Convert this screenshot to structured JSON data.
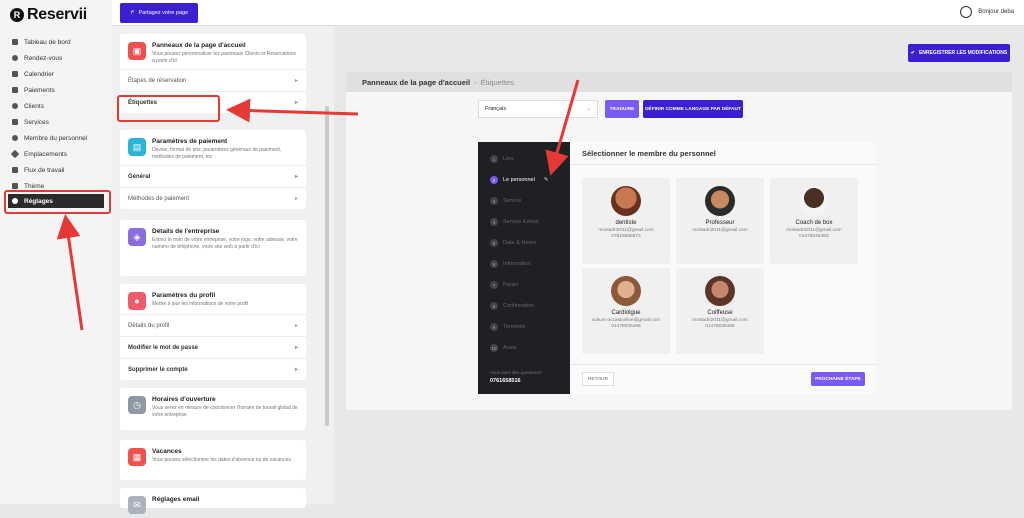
{
  "brand": {
    "logo_letter": "R",
    "name": "Reservii"
  },
  "sidebar": {
    "items": [
      {
        "label": "Tableau de bord",
        "icon": "dashboard-icon"
      },
      {
        "label": "Rendez-vous",
        "icon": "clock-icon"
      },
      {
        "label": "Calendrier",
        "icon": "calendar-icon"
      },
      {
        "label": "Paiements",
        "icon": "payment-icon"
      },
      {
        "label": "Clients",
        "icon": "users-icon"
      },
      {
        "label": "Services",
        "icon": "services-icon"
      },
      {
        "label": "Membre du personnel",
        "icon": "user-icon"
      },
      {
        "label": "Emplacements",
        "icon": "location-icon"
      },
      {
        "label": "Flux de travail",
        "icon": "workflow-icon"
      },
      {
        "label": "Thème",
        "icon": "theme-icon"
      },
      {
        "label": "Réglages",
        "icon": "gear-icon"
      }
    ]
  },
  "topbar": {
    "share_label": "Partagez votre page",
    "user_label": "Bonjour deba"
  },
  "settings": {
    "cards": [
      {
        "title": "Panneaux de la page d'accueil",
        "desc": "Vous pouvez personnaliser les panneaux Clients et Réservations à partir d'ici",
        "rows": [
          "Étapes de réservation",
          "Étiquettes"
        ]
      },
      {
        "title": "Paramètres de paiement",
        "desc": "Devise, format de prix, paramètres généraux de paiement, méthodes de paiement, etc",
        "rows": [
          "Général",
          "Méthodes de paiement"
        ]
      },
      {
        "title": "Détails de l'entreprise",
        "desc": "Entrez le nom de votre entreprise, votre logo, votre adresse, votre numéro de téléphone, votre site web à partir d'ici",
        "rows": []
      },
      {
        "title": "Paramètres du profil",
        "desc": "Mettre à jour les informations de votre profil",
        "rows": [
          "Détails du profil",
          "Modifier le mot de passe",
          "Supprimer le compte"
        ]
      },
      {
        "title": "Horaires d'ouverture",
        "desc": "Vous serez en mesure de coordonner l'horaire de travail global de votre entreprise",
        "rows": []
      },
      {
        "title": "Vacances",
        "desc": "Vous pouvez sélectionner les dates d'absence ou de vacances",
        "rows": []
      },
      {
        "title": "Réglages email",
        "desc": "",
        "rows": []
      }
    ]
  },
  "main": {
    "save_label": "ENREGISTRER LES MODIFICATIONS",
    "breadcrumb_title": "Panneaux de la page d'accueil",
    "breadcrumb_sep": "-",
    "breadcrumb_sub": "Étiquettes",
    "language_value": "Français",
    "translate_label": "TRADUIRE",
    "default_lang_label": "DÉFINIR COMME LANGAGE PAR DÉFAUT"
  },
  "wizard": {
    "steps": [
      {
        "n": "1",
        "label": "Lieu"
      },
      {
        "n": "2",
        "label": "Le personnel"
      },
      {
        "n": "3",
        "label": "Service"
      },
      {
        "n": "4",
        "label": "Service Extras"
      },
      {
        "n": "5",
        "label": "Date & Heure"
      },
      {
        "n": "6",
        "label": "Information"
      },
      {
        "n": "7",
        "label": "Panier"
      },
      {
        "n": "8",
        "label": "Confirmation"
      },
      {
        "n": "9",
        "label": "Terminée"
      },
      {
        "n": "10",
        "label": "Aussi"
      }
    ],
    "help_label": "Vous avez des questions?",
    "help_phone": "0761658516",
    "title": "Sélectionner le membre du personnel",
    "staff": [
      {
        "name": "dentiste",
        "email": "mostadri2011@gmail.com",
        "phone": "07615656873"
      },
      {
        "name": "Professeur",
        "email": "mostadri2011@gmail.com",
        "phone": ""
      },
      {
        "name": "Coach de box",
        "email": "mostadri2011@gmail.com",
        "phone": "0147803548S"
      },
      {
        "name": "Cardiolgue",
        "email": "voiture.occasionlive@gmail.com",
        "phone": "01478035466"
      },
      {
        "name": "Coiffeuse",
        "email": "mostadri2011@gmail.com",
        "phone": "01478035465"
      }
    ],
    "back_label": "RETOUR",
    "next_label": "PROCHAINE ÉTAPE"
  },
  "colors": {
    "primary": "#3b1fd1",
    "accent": "#7a5af5",
    "annotation": "#e53935"
  }
}
